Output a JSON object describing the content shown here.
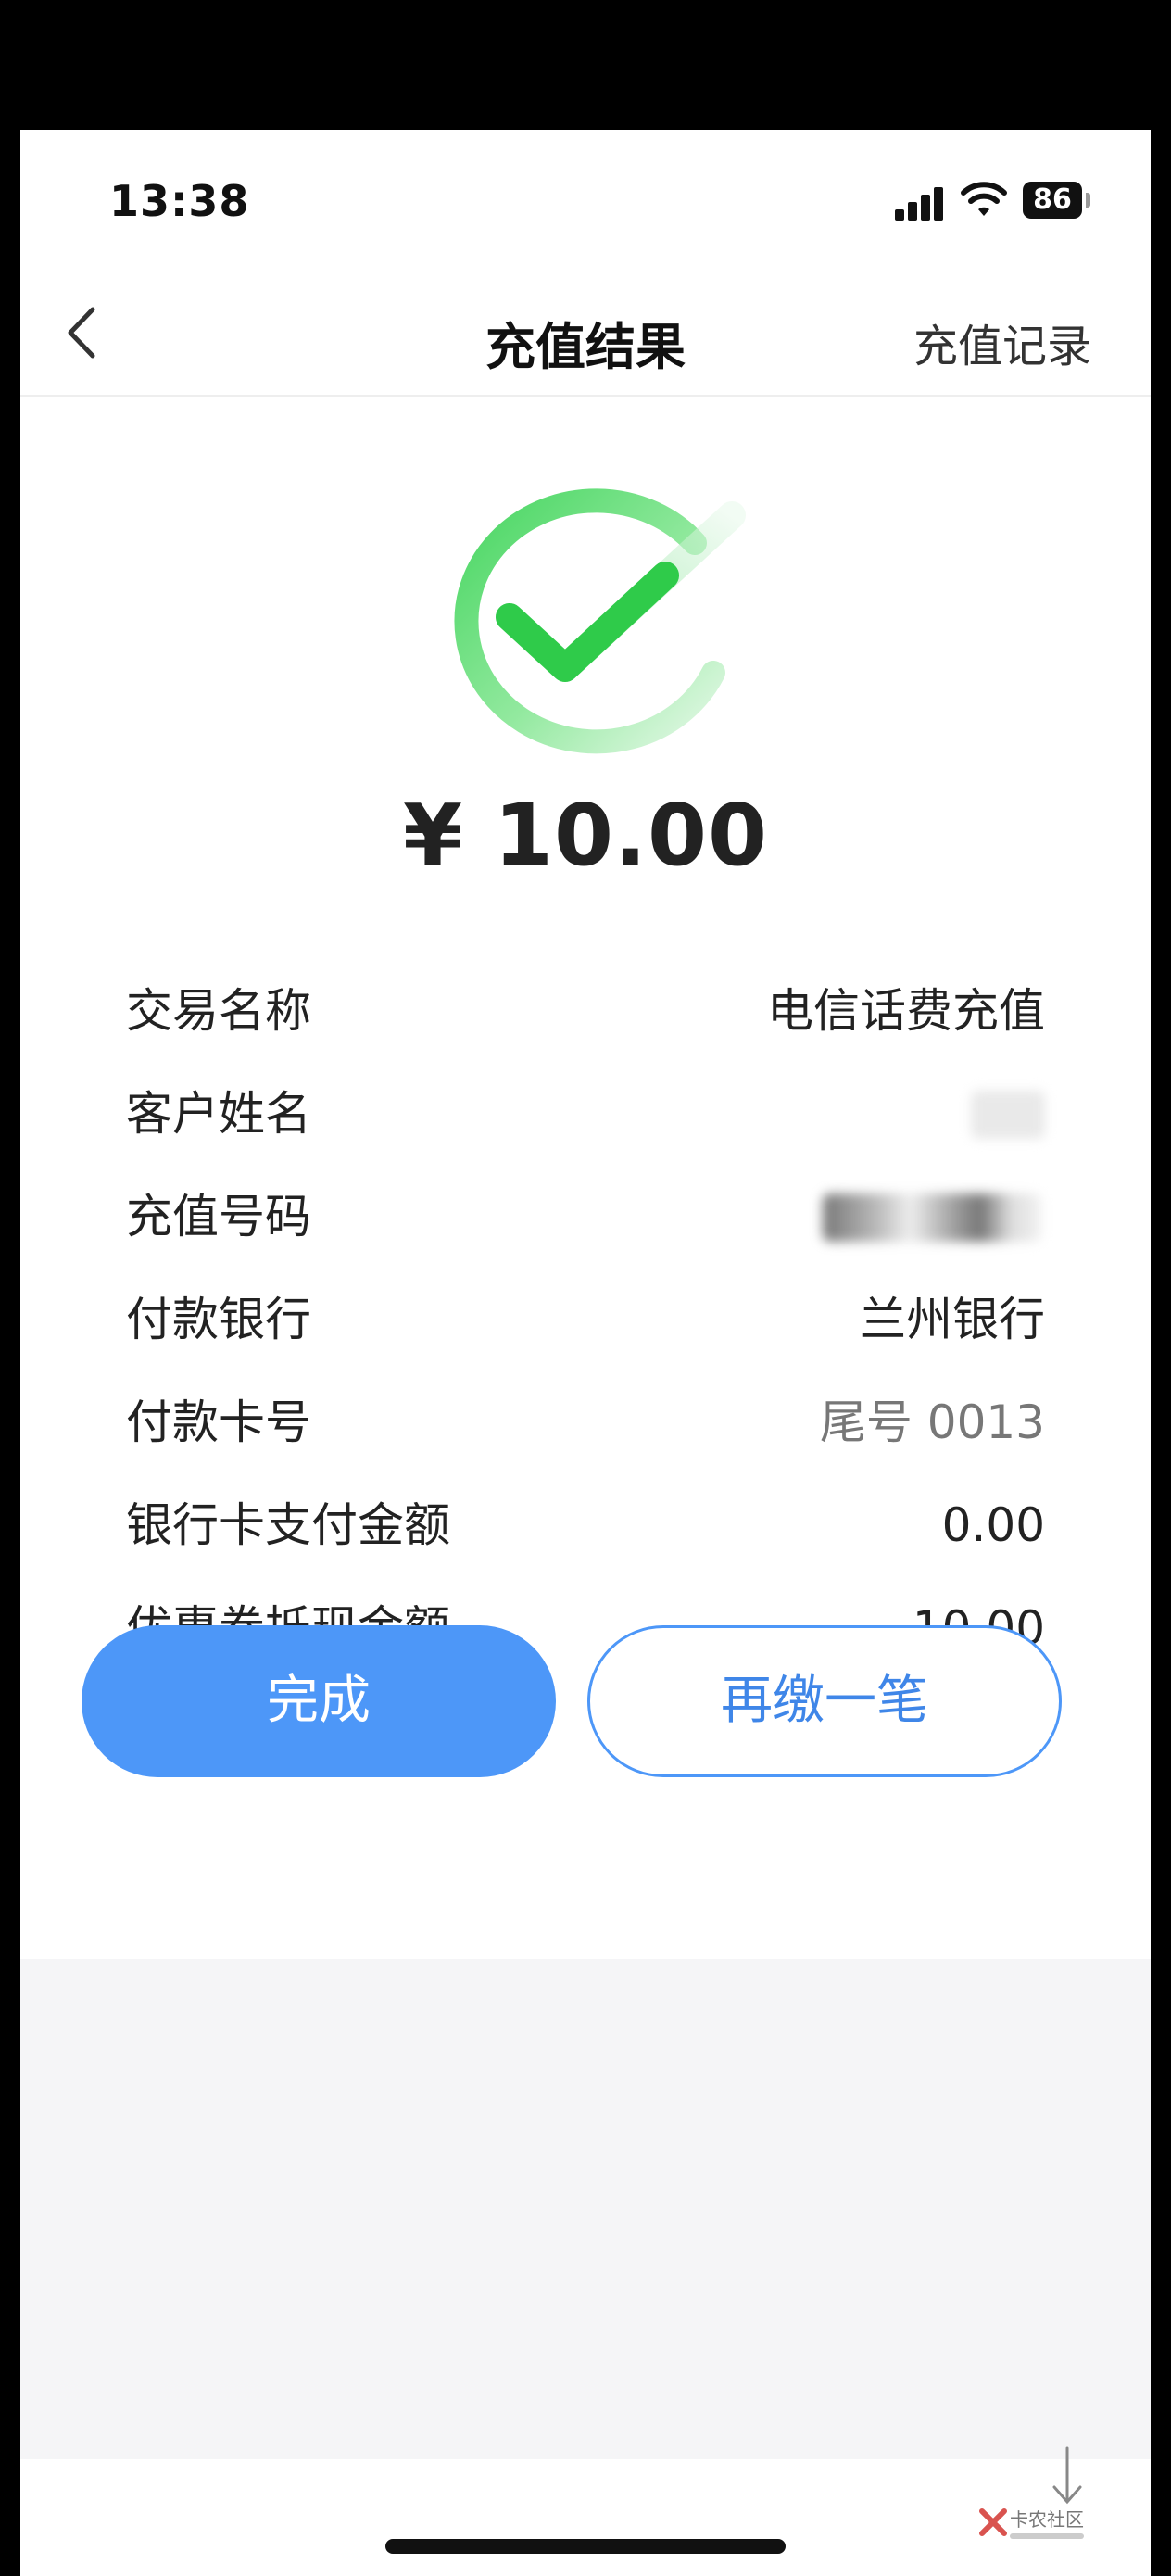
{
  "status_bar": {
    "time": "13:38",
    "battery": "86"
  },
  "nav": {
    "title": "充值结果",
    "right_link": "充值记录"
  },
  "result": {
    "amount": "¥ 10.00"
  },
  "details": [
    {
      "label": "交易名称",
      "value": "电信话费充值"
    },
    {
      "label": "客户姓名",
      "value": ""
    },
    {
      "label": "充值号码",
      "value": ""
    },
    {
      "label": "付款银行",
      "value": "兰州银行"
    },
    {
      "label": "付款卡号",
      "value": "尾号 0013"
    },
    {
      "label": "银行卡支付金额",
      "value": "0.00"
    },
    {
      "label": "优惠券抵现金额",
      "value": "10.00"
    }
  ],
  "actions": {
    "done": "完成",
    "pay_again": "再缴一笔"
  },
  "watermark": {
    "text": "卡农社区"
  },
  "colors": {
    "primary": "#4d97f8",
    "success_green": "#2fcb4a"
  }
}
